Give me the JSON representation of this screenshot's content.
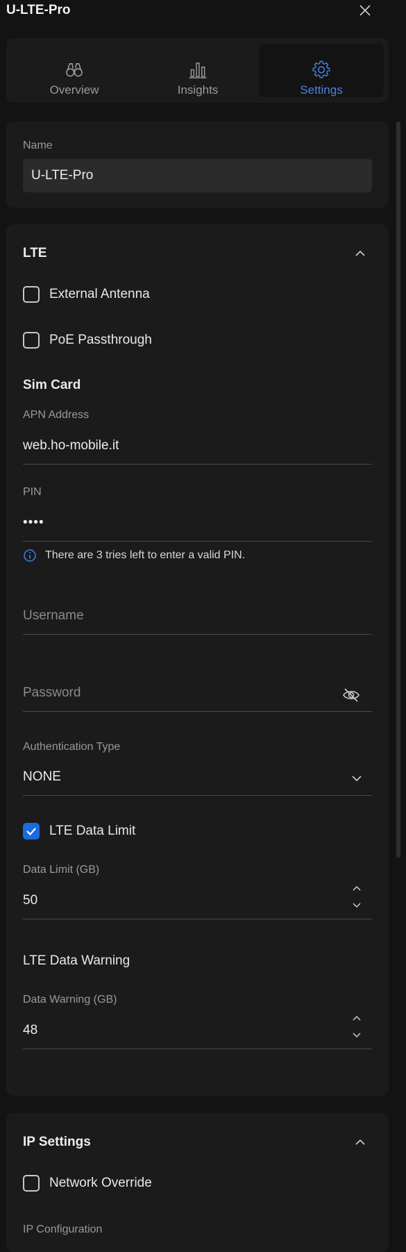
{
  "window": {
    "title": "U-LTE-Pro"
  },
  "tabs": [
    {
      "label": "Overview",
      "icon": "binoculars-icon"
    },
    {
      "label": "Insights",
      "icon": "bar-chart-icon"
    },
    {
      "label": "Settings",
      "icon": "gear-icon",
      "active": true
    }
  ],
  "name_section": {
    "label": "Name",
    "value": "U-LTE-Pro"
  },
  "lte": {
    "title": "LTE",
    "external_antenna": {
      "label": "External Antenna",
      "checked": false
    },
    "poe_passthrough": {
      "label": "PoE Passthrough",
      "checked": false
    },
    "sim_card_heading": "Sim Card",
    "apn": {
      "label": "APN Address",
      "value": "web.ho-mobile.it"
    },
    "pin": {
      "label": "PIN",
      "value": "••••"
    },
    "pin_info": "There are 3 tries left to enter a valid PIN.",
    "username": {
      "placeholder": "Username"
    },
    "password": {
      "placeholder": "Password"
    },
    "auth_type": {
      "label": "Authentication Type",
      "value": "NONE"
    },
    "data_limit_toggle": {
      "label": "LTE Data Limit",
      "checked": true
    },
    "data_limit": {
      "label": "Data Limit (GB)",
      "value": "50"
    },
    "data_warning_heading": "LTE Data Warning",
    "data_warning": {
      "label": "Data Warning (GB)",
      "value": "48"
    }
  },
  "ip_settings": {
    "title": "IP Settings",
    "network_override": {
      "label": "Network Override",
      "checked": false
    },
    "ip_configuration_label": "IP Configuration"
  },
  "colors": {
    "accent": "#1a6be0",
    "active_tab_text": "#4a82e6",
    "background": "#131313",
    "card": "#1b1b1b"
  }
}
